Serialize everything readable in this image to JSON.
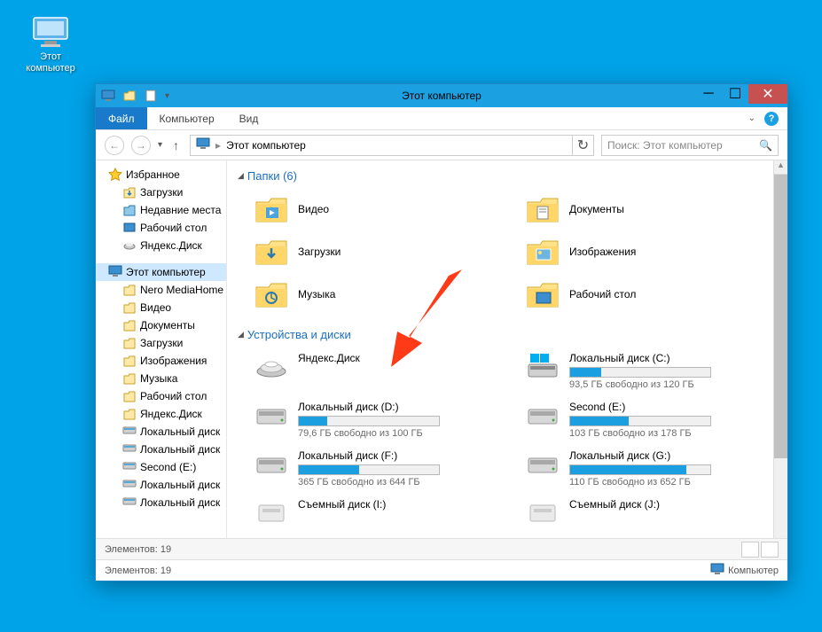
{
  "desktop": {
    "label": "Этот\nкомпьютер"
  },
  "window": {
    "title": "Этот компьютер",
    "ribbon": {
      "file": "Файл",
      "computer": "Компьютер",
      "view": "Вид"
    },
    "breadcrumb": "Этот компьютер",
    "search_placeholder": "Поиск: Этот компьютер"
  },
  "sidebar": {
    "favorites": "Избранное",
    "fav_items": [
      "Загрузки",
      "Недавние места",
      "Рабочий стол",
      "Яндекс.Диск"
    ],
    "this_pc": "Этот компьютер",
    "pc_items": [
      "Nero MediaHome",
      "Видео",
      "Документы",
      "Загрузки",
      "Изображения",
      "Музыка",
      "Рабочий стол",
      "Яндекс.Диск",
      "Локальный диск",
      "Локальный диск",
      "Second (E:)",
      "Локальный диск",
      "Локальный диск"
    ]
  },
  "sections": {
    "folders_header": "Папки (6)",
    "devices_header": "Устройства и диски"
  },
  "folders": [
    {
      "name": "Видео"
    },
    {
      "name": "Документы"
    },
    {
      "name": "Загрузки"
    },
    {
      "name": "Изображения"
    },
    {
      "name": "Музыка"
    },
    {
      "name": "Рабочий стол"
    }
  ],
  "drives": [
    {
      "name": "Яндекс.Диск",
      "type": "yandex"
    },
    {
      "name": "Локальный диск (C:)",
      "free": "93,5 ГБ свободно из 120 ГБ",
      "fill": 22,
      "type": "os"
    },
    {
      "name": "Локальный диск (D:)",
      "free": "79,6 ГБ свободно из 100 ГБ",
      "fill": 20,
      "type": "hdd"
    },
    {
      "name": "Second (E:)",
      "free": "103 ГБ свободно из 178 ГБ",
      "fill": 42,
      "type": "hdd"
    },
    {
      "name": "Локальный диск (F:)",
      "free": "365 ГБ свободно из 644 ГБ",
      "fill": 43,
      "type": "hdd"
    },
    {
      "name": "Локальный диск (G:)",
      "free": "110 ГБ свободно из 652 ГБ",
      "fill": 83,
      "type": "hdd"
    },
    {
      "name": "Съемный диск (I:)",
      "type": "removable"
    },
    {
      "name": "Съемный диск (J:)",
      "type": "removable"
    }
  ],
  "status": {
    "items_inner": "Элементов: 19",
    "items_outer": "Элементов: 19",
    "location": "Компьютер"
  }
}
